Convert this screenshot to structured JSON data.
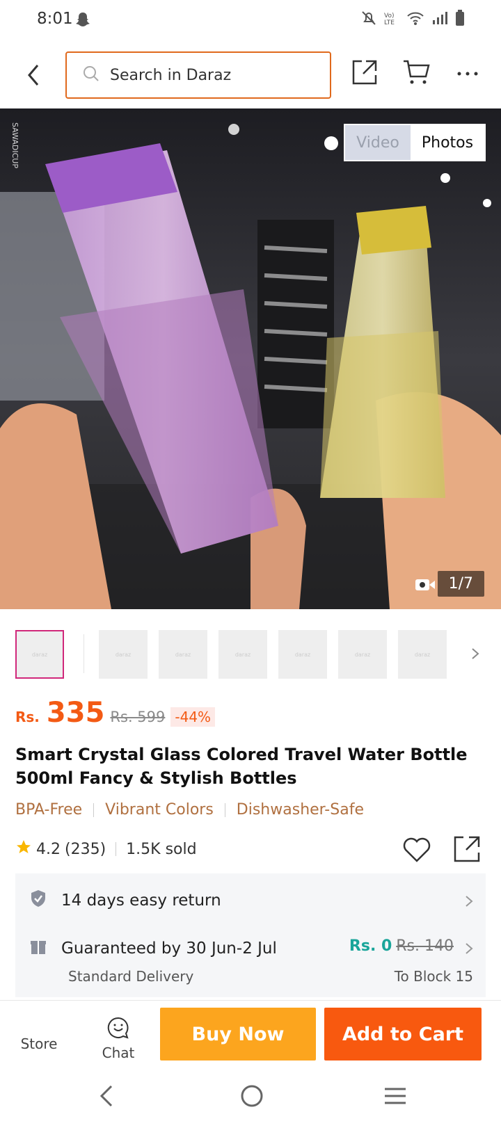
{
  "status": {
    "time": "8:01",
    "network_label": "Vo) LTE"
  },
  "header": {
    "search_placeholder": "Search in Daraz"
  },
  "gallery": {
    "toggle_video": "Video",
    "toggle_photos": "Photos",
    "counter": "1/7",
    "thumbnail_count": 7
  },
  "product": {
    "currency": "Rs.",
    "price": "335",
    "original_price": "Rs. 599",
    "discount": "-44%",
    "title": "Smart Crystal Glass Colored Travel Water Bottle 500ml Fancy & Stylish Bottles",
    "tags": [
      "BPA-Free",
      "Vibrant Colors",
      "Dishwasher-Safe"
    ],
    "rating": "4.2",
    "reviews": "(235)",
    "sold": "1.5K sold"
  },
  "service": {
    "return_text": "14 days easy return",
    "delivery_text": "Guaranteed by 30 Jun-2 Jul",
    "delivery_type": "Standard Delivery",
    "delivery_fee": "Rs. 0",
    "delivery_fee_original": "Rs. 140",
    "destination": "To Block 15"
  },
  "bottom_bar": {
    "store_label": "Store",
    "chat_label": "Chat",
    "buy_now_label": "Buy Now",
    "add_to_cart_label": "Add to Cart"
  },
  "colors": {
    "accent_orange": "#f35a14",
    "buy_now": "#fca51e",
    "add_to_cart": "#f8590f",
    "search_border": "#e0691c",
    "free_delivery": "#1aa59a"
  }
}
